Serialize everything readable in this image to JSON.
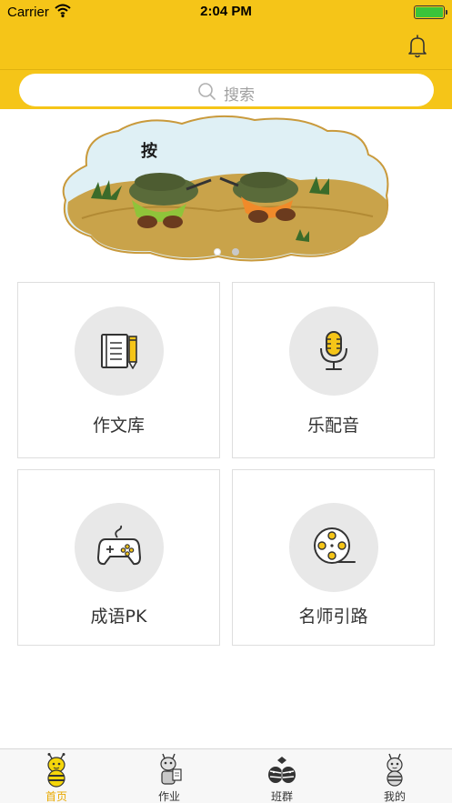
{
  "status_bar": {
    "carrier": "Carrier",
    "time": "2:04 PM"
  },
  "header": {
    "bell_icon": "bell-icon"
  },
  "search": {
    "placeholder": "搜索",
    "icon": "search-icon"
  },
  "banner": {
    "caption": "按",
    "page_count": 2,
    "active_page": 1
  },
  "grid": {
    "items": [
      {
        "label": "作文库",
        "icon": "notebook-pencil-icon"
      },
      {
        "label": "乐配音",
        "icon": "microphone-icon"
      },
      {
        "label": "成语PK",
        "icon": "gamepad-icon"
      },
      {
        "label": "名师引路",
        "icon": "film-reel-icon"
      }
    ]
  },
  "tabbar": {
    "items": [
      {
        "label": "首页",
        "icon": "bee-home-icon",
        "active": true
      },
      {
        "label": "作业",
        "icon": "bee-homework-icon",
        "active": false
      },
      {
        "label": "班群",
        "icon": "zebra-class-icon",
        "active": false
      },
      {
        "label": "我的",
        "icon": "bee-profile-icon",
        "active": false
      }
    ]
  },
  "colors": {
    "brand_yellow": "#f5c518",
    "active_tab": "#e8a800",
    "circle_bg": "#e8e8e8"
  }
}
